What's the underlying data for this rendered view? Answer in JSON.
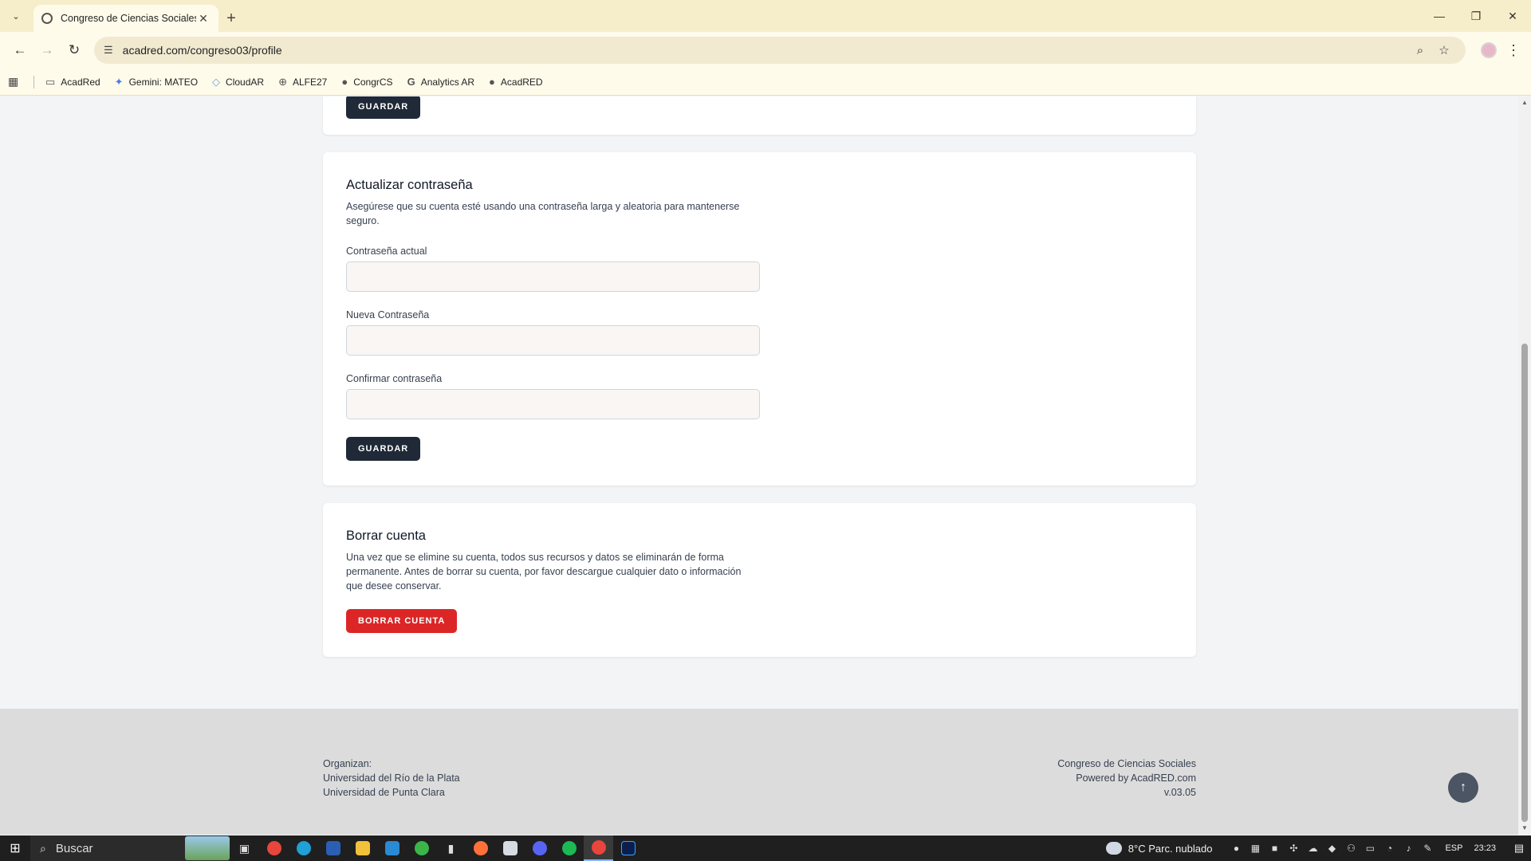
{
  "browser": {
    "tab_title": "Congreso de Ciencias Sociales",
    "url": "acadred.com/congreso03/profile",
    "bookmarks": [
      {
        "label": "AcadRed",
        "icon": "folder-icon"
      },
      {
        "label": "Gemini: MATEO",
        "icon": "gemini-icon"
      },
      {
        "label": "CloudAR",
        "icon": "cloud-icon"
      },
      {
        "label": "ALFE27",
        "icon": "globe-icon"
      },
      {
        "label": "CongrCS",
        "icon": "globe-icon"
      },
      {
        "label": "Analytics AR",
        "icon": "google-icon"
      },
      {
        "label": "AcadRED",
        "icon": "globe-icon"
      }
    ]
  },
  "profile_top": {
    "save_label": "GUARDAR"
  },
  "password_section": {
    "title": "Actualizar contraseña",
    "description": "Asegúrese que su cuenta esté usando una contraseña larga y aleatoria para mantenerse seguro.",
    "current_label": "Contraseña actual",
    "current_value": "",
    "new_label": "Nueva Contraseña",
    "new_value": "",
    "confirm_label": "Confirmar contraseña",
    "confirm_value": "",
    "save_label": "GUARDAR"
  },
  "delete_section": {
    "title": "Borrar cuenta",
    "description": "Una vez que se elimine su cuenta, todos sus recursos y datos se eliminarán de forma permanente. Antes de borrar su cuenta, por favor descargue cualquier dato o información que desee conservar.",
    "button_label": "BORRAR CUENTA"
  },
  "footer": {
    "left": [
      "Organizan:",
      "Universidad del Río de la Plata",
      "Universidad de Punta Clara"
    ],
    "right": [
      "Congreso de Ciencias Sociales",
      "Powered by AcadRED.com",
      "v.03.05"
    ]
  },
  "taskbar": {
    "search_placeholder": "Buscar",
    "weather": "8°C  Parc. nublado",
    "lang": "ESP",
    "time": "23:23"
  },
  "colors": {
    "dark_button": "#1f2937",
    "danger_button": "#dc2626",
    "chrome_bg": "#fffbeb"
  }
}
